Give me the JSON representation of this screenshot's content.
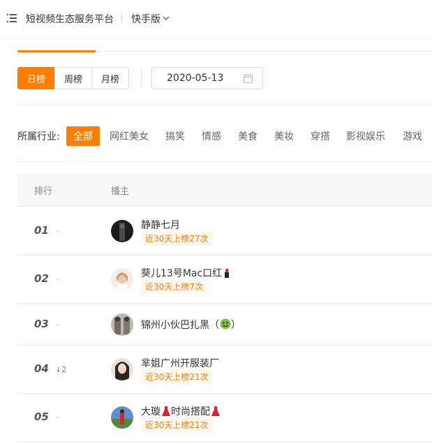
{
  "header": {
    "title": "短视频生态服务平台",
    "version": "快手版"
  },
  "period_tabs": [
    "日榜",
    "周榜",
    "月榜"
  ],
  "date": "2020-05-13",
  "industry": {
    "label": "所属行业:",
    "items": [
      "全部",
      "网红美女",
      "搞笑",
      "情感",
      "美食",
      "美妆",
      "穿搭",
      "影视娱乐",
      "游戏"
    ]
  },
  "table": {
    "headers": {
      "rank": "排行",
      "host": "播主"
    },
    "rows": [
      {
        "rank": "01",
        "trend": "–",
        "name": "静静七月",
        "badge": "近30天上榜27次"
      },
      {
        "rank": "02",
        "trend": "–",
        "name": "葵儿13号Mac口红",
        "badge": "近30天上榜7次"
      },
      {
        "rank": "03",
        "trend": "–",
        "name": "锦州小伙巴扎黑（",
        "name_suffix": "）",
        "badge": ""
      },
      {
        "rank": "04",
        "trend": "↓2",
        "name": "芈姐广州开服装厂",
        "badge": "近30天上榜21次"
      },
      {
        "rank": "05",
        "trend": "–",
        "name": "大璇",
        "name_mid": "时尚搭配",
        "badge": "近30天上榜21次"
      }
    ]
  },
  "colors": {
    "accent": "#ff7e00",
    "badge_bg": "#fff6ec",
    "trend_down": "#2db37d"
  }
}
